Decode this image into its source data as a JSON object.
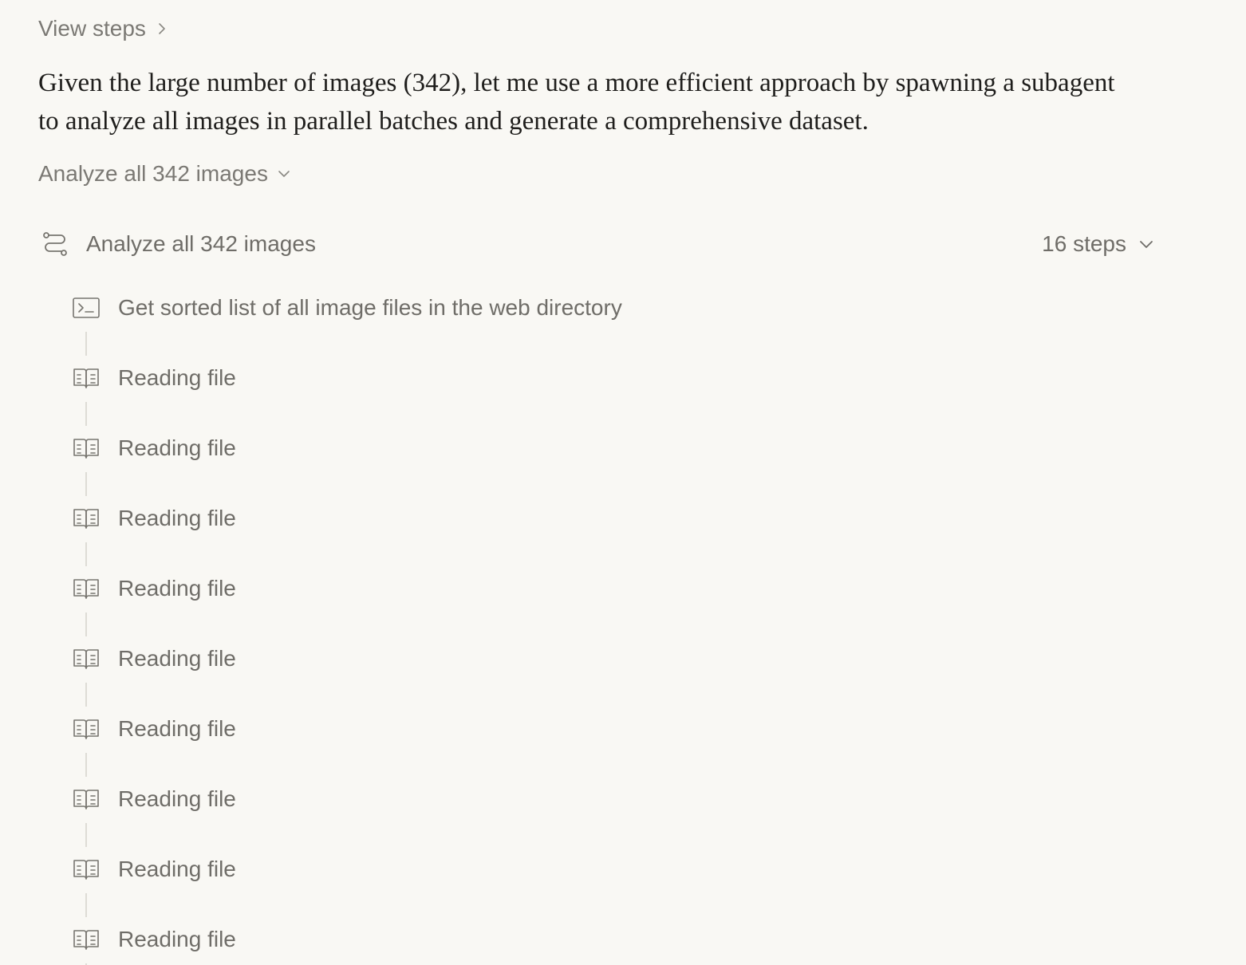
{
  "view_steps_label": "View steps",
  "message": "Given the large number of images (342), let me use a more efficient approach by spawning a subagent to analyze all images in parallel batches and generate a comprehensive dataset.",
  "analyze_toggle_label": "Analyze all 342 images",
  "task": {
    "title": "Analyze all 342 images",
    "steps_count": "16 steps"
  },
  "steps": [
    {
      "icon": "terminal-icon",
      "label": "Get sorted list of all image files in the web directory"
    },
    {
      "icon": "book-icon",
      "label": "Reading file"
    },
    {
      "icon": "book-icon",
      "label": "Reading file"
    },
    {
      "icon": "book-icon",
      "label": "Reading file"
    },
    {
      "icon": "book-icon",
      "label": "Reading file"
    },
    {
      "icon": "book-icon",
      "label": "Reading file"
    },
    {
      "icon": "book-icon",
      "label": "Reading file"
    },
    {
      "icon": "book-icon",
      "label": "Reading file"
    },
    {
      "icon": "book-icon",
      "label": "Reading file"
    },
    {
      "icon": "book-icon",
      "label": "Reading file"
    }
  ]
}
